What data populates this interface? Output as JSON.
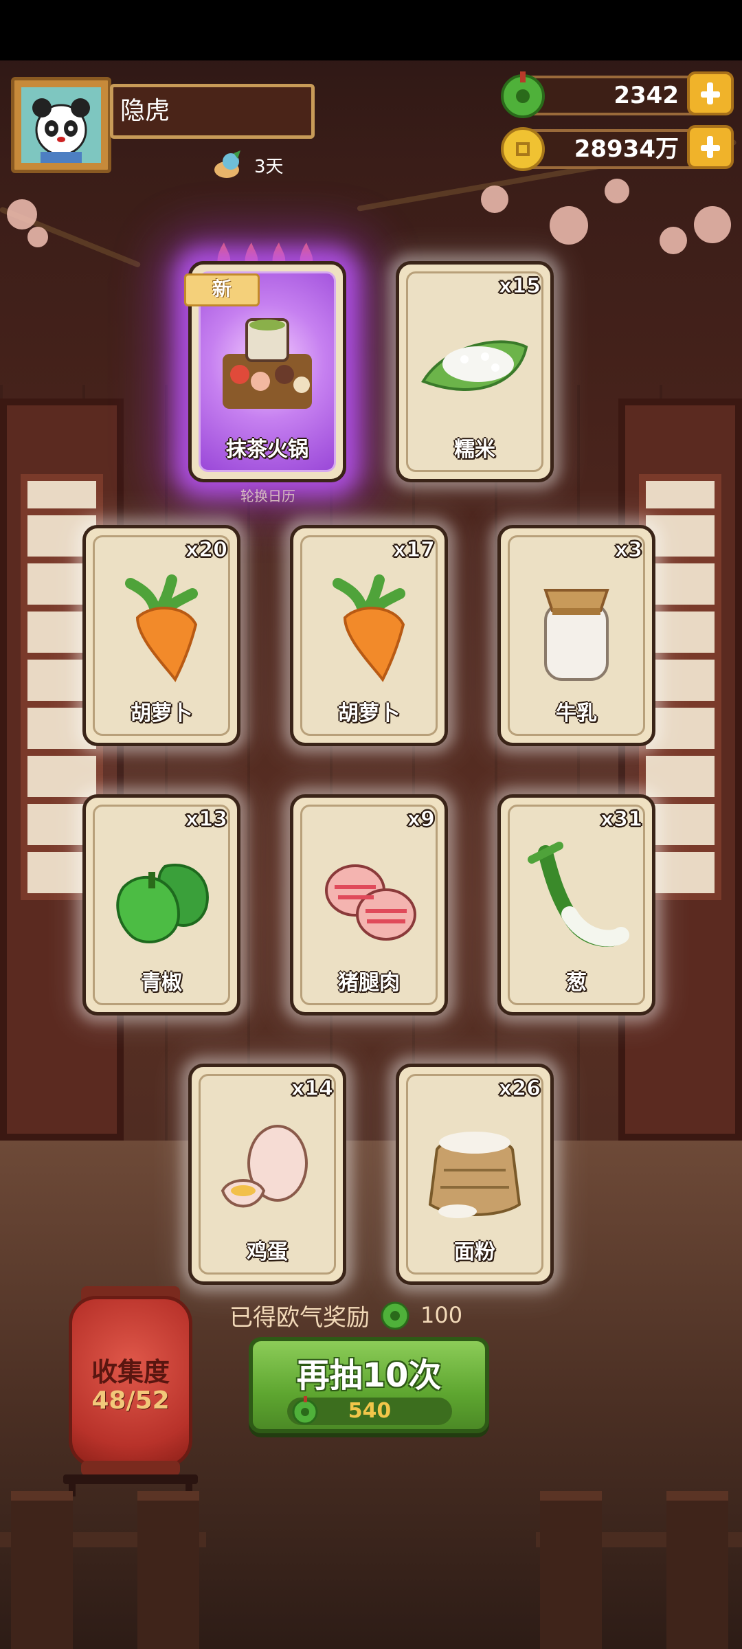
{
  "player": {
    "name": "隐虎",
    "days": "3天"
  },
  "currencies": {
    "jade": "2342",
    "coins": "28934万"
  },
  "featured_card": {
    "badge": "新",
    "label": "抹茶火锅",
    "caption": "轮换日历"
  },
  "cards": [
    {
      "label": "糯米",
      "count": "x15",
      "icon": "rice-icon"
    },
    {
      "label": "胡萝卜",
      "count": "x20",
      "icon": "carrot-icon"
    },
    {
      "label": "胡萝卜",
      "count": "x17",
      "icon": "carrot-icon"
    },
    {
      "label": "牛乳",
      "count": "x3",
      "icon": "milk-jar-icon"
    },
    {
      "label": "青椒",
      "count": "x13",
      "icon": "green-pepper-icon"
    },
    {
      "label": "猪腿肉",
      "count": "x9",
      "icon": "pork-icon"
    },
    {
      "label": "葱",
      "count": "x31",
      "icon": "scallion-icon"
    },
    {
      "label": "鸡蛋",
      "count": "x14",
      "icon": "egg-icon"
    },
    {
      "label": "面粉",
      "count": "x26",
      "icon": "flour-sack-icon"
    }
  ],
  "reward": {
    "text": "已得欧气奖励",
    "amount": "100"
  },
  "collection": {
    "title": "收集度",
    "progress": "48/52"
  },
  "draw_button": {
    "label": "再抽10次",
    "cost": "540"
  }
}
